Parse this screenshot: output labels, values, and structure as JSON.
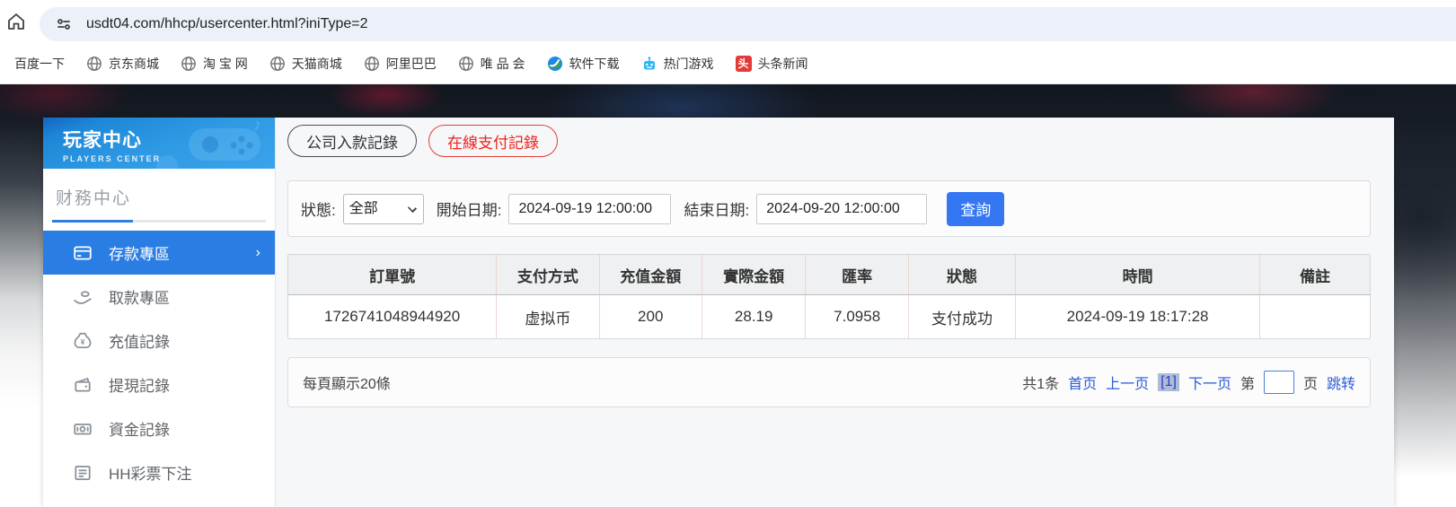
{
  "colors": {
    "accent_blue": "#2a7de3",
    "button_blue": "#3577f2",
    "tab_red": "#f0211a",
    "link_blue": "#2d5bd7",
    "header_gradient_top": "#1565c0",
    "header_gradient_bottom": "#39a4ea"
  },
  "icons": {
    "browser_home": "home-icon",
    "omnibox_privacy": "tune-icon",
    "bookmark_default": "globe-icon",
    "software_bookmark": "software-icon",
    "game_bookmark": "robot-icon",
    "news_bookmark": "toutiao-icon",
    "active_menu_arrow": "chevron-right-icon",
    "header_decoration": "gamepad-icon"
  },
  "browser": {
    "url": "usdt04.com/hhcp/usercenter.html?iniType=2",
    "bookmarks": [
      {
        "label": "百度一下",
        "icon": "none"
      },
      {
        "label": "京东商城",
        "icon": "globe"
      },
      {
        "label": "淘 宝 网",
        "icon": "globe"
      },
      {
        "label": "天猫商城",
        "icon": "globe"
      },
      {
        "label": "阿里巴巴",
        "icon": "globe"
      },
      {
        "label": "唯 品 会",
        "icon": "globe"
      },
      {
        "label": "软件下载",
        "icon": "software"
      },
      {
        "label": "热门游戏",
        "icon": "game"
      },
      {
        "label": "头条新闻",
        "icon": "toutiao",
        "badge_char": "头"
      }
    ]
  },
  "sidebar": {
    "title": "玩家中心",
    "subtitle": "PLAYERS CENTER",
    "section": "财務中心",
    "items": [
      {
        "label": "存款專區",
        "icon": "deposit-card",
        "active": true
      },
      {
        "label": "取款專區",
        "icon": "withdraw-hand",
        "active": false
      },
      {
        "label": "充值記錄",
        "icon": "recharge-bag",
        "active": false
      },
      {
        "label": "提現記錄",
        "icon": "cashout-wallet",
        "active": false
      },
      {
        "label": "資金記錄",
        "icon": "funds-cash",
        "active": false
      },
      {
        "label": "HH彩票下注",
        "icon": "lottery-list",
        "active": false
      }
    ]
  },
  "tabs": [
    {
      "label": "公司入款記錄",
      "active": false
    },
    {
      "label": "在線支付記錄",
      "active": true
    }
  ],
  "filter": {
    "status_label": "狀態:",
    "status_value": "全部",
    "start_label": "開始日期:",
    "start_value": "2024-09-19 12:00:00",
    "end_label": "結束日期:",
    "end_value": "2024-09-20 12:00:00",
    "query_button": "查詢"
  },
  "table": {
    "headers": [
      "訂單號",
      "支付方式",
      "充值金額",
      "實際金額",
      "匯率",
      "狀態",
      "時間",
      "備註"
    ],
    "rows": [
      [
        "1726741048944920",
        "虚拟币",
        "200",
        "28.19",
        "7.0958",
        "支付成功",
        "2024-09-19 18:17:28",
        ""
      ]
    ]
  },
  "pagination": {
    "page_size_text": "每頁顯示20條",
    "total_text": "共1条",
    "first": "首页",
    "prev": "上一页",
    "current": "[1]",
    "next": "下一页",
    "jump_prefix": "第",
    "jump_suffix": "页",
    "jump_action": "跳转",
    "page_input_value": ""
  }
}
